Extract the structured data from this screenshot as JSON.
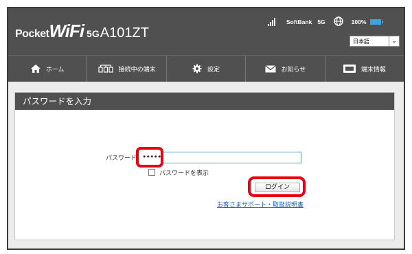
{
  "header": {
    "logo": {
      "pocket": "Pocket",
      "wifi": "WiFi",
      "fiveg": "5G",
      "model": "A101ZT"
    },
    "status": {
      "carrier": "SoftBank",
      "network": "5G",
      "battery": "100%"
    },
    "language": {
      "selected": "日本語"
    }
  },
  "nav": {
    "items": [
      {
        "label": "ホーム",
        "icon": "home-icon"
      },
      {
        "label": "接続中の端末",
        "icon": "devices-icon"
      },
      {
        "label": "設定",
        "icon": "settings-icon"
      },
      {
        "label": "お知らせ",
        "icon": "mail-icon"
      },
      {
        "label": "端末情報",
        "icon": "device-info-icon"
      }
    ]
  },
  "login": {
    "title": "パスワードを入力",
    "password_label": "パスワード",
    "password_value": "•••••",
    "show_password_label": "パスワードを表示",
    "login_button": "ログイン",
    "support_link": "お客さまサポート・取扱説明書"
  },
  "colors": {
    "header_bg": "#505050",
    "highlight": "#e60012",
    "battery": "#3ba4e0",
    "link": "#1a5fb4"
  }
}
